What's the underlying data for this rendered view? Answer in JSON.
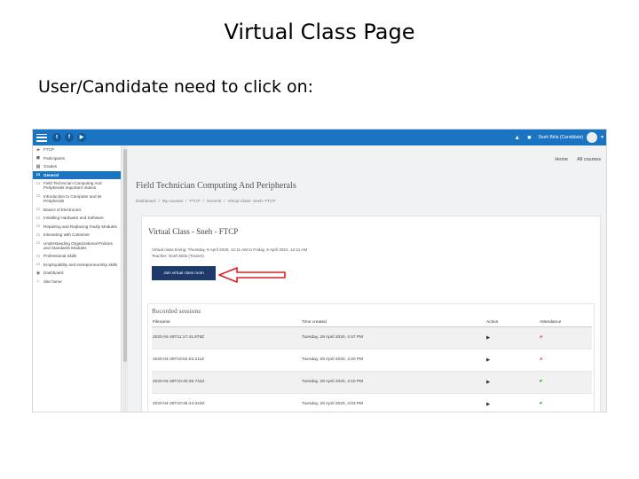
{
  "slide": {
    "title": "Virtual Class Page",
    "subtitle": "User/Candidate need to click on:"
  },
  "topbar": {
    "social": [
      "t",
      "f",
      "▶"
    ],
    "user_label": "Sneh Birla (Candidate)"
  },
  "sidebar": {
    "items": [
      {
        "label": "FTCP",
        "icon": "hat-icon",
        "active": false
      },
      {
        "label": "Participants",
        "icon": "people-icon",
        "active": false
      },
      {
        "label": "Grades",
        "icon": "grades-icon",
        "active": false
      },
      {
        "label": "General",
        "icon": "folder-icon",
        "active": true
      },
      {
        "label": "Field Technician Computing And Peripherals Important Videos",
        "icon": "folder-icon",
        "active": false
      },
      {
        "label": "Introduction to Computer and its Peripherals",
        "icon": "folder-icon",
        "active": false
      },
      {
        "label": "Basics of Electronics",
        "icon": "folder-icon",
        "active": false
      },
      {
        "label": "Installing Hardware and Software",
        "icon": "folder-icon",
        "active": false
      },
      {
        "label": "Repairing and Replacing Faulty Modules",
        "icon": "folder-icon",
        "active": false
      },
      {
        "label": "Interacting with Customer",
        "icon": "folder-icon",
        "active": false
      },
      {
        "label": "Understanding Organizational Policies and Standards Modules",
        "icon": "folder-icon",
        "active": false
      },
      {
        "label": "Professional Skills",
        "icon": "folder-icon",
        "active": false
      },
      {
        "label": "Employability and entrepreneurship skills",
        "icon": "folder-icon",
        "active": false
      },
      {
        "label": "Dashboard",
        "icon": "dashboard-icon",
        "active": false
      },
      {
        "label": "Site home",
        "icon": "home-icon",
        "active": false
      }
    ]
  },
  "nav_links": [
    "Home",
    "All courses"
  ],
  "course": {
    "title": "Field Technician Computing And Peripherals",
    "breadcrumb": [
      "Dashboard",
      "/",
      "My courses",
      "/",
      "FTCP",
      "/",
      "General",
      "/",
      "Virtual Class- Sneh- FTCP"
    ]
  },
  "virtual_class": {
    "title": "Virtual Class - Sneh - FTCP",
    "timing": "Virtual class timing: Thursday, 9 April 2020, 12:11 AM to Friday, 9 April 2021, 12:11 AM",
    "teacher": "Teacher: Sneh Birla (Trainer)",
    "join_button": "Join virtual class room"
  },
  "recorded": {
    "title": "Recorded sessions",
    "headers": [
      "Filename",
      "Time created",
      "Action",
      "Attendance"
    ],
    "rows": [
      {
        "filename": "2020-04-28T11:17:41.979Z",
        "time": "Tuesday, 28 April 2020, 4:47 PM",
        "attendance": "A"
      },
      {
        "filename": "2020-04-28T10:52:03.211Z",
        "time": "Tuesday, 28 April 2020, 4:20 PM",
        "attendance": "A"
      },
      {
        "filename": "2020-04-28T10:40:35.742Z",
        "time": "Tuesday, 28 April 2020, 4:10 PM",
        "attendance": "P"
      },
      {
        "filename": "2020-04-28T10:35:44.043Z",
        "time": "Tuesday, 28 April 2020, 4:03 PM",
        "attendance": "P"
      }
    ]
  },
  "colors": {
    "topbar": "#1b74c2",
    "active_item": "#1b74c2",
    "join_button": "#1d3a6b",
    "arrow": "#d62020",
    "absent": "#d12b2b",
    "present": "#2e9b2e"
  }
}
